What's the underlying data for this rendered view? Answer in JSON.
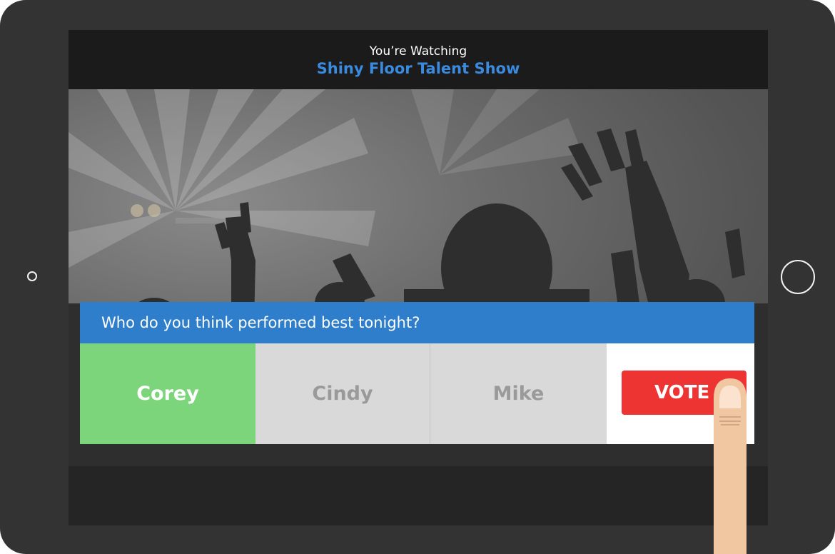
{
  "header": {
    "subtitle": "You’re Watching",
    "show_title": "Shiny Floor Talent Show"
  },
  "poll": {
    "question": "Who do you think performed best tonight?",
    "options": [
      {
        "label": "Corey",
        "selected": true
      },
      {
        "label": "Cindy",
        "selected": false
      },
      {
        "label": "Mike",
        "selected": false
      }
    ],
    "vote_label": "VOTE"
  },
  "colors": {
    "accent_blue": "#2f7ecb",
    "title_blue": "#3a8be0",
    "selected_green": "#7cd57a",
    "unselected_gray": "#d9d9d9",
    "vote_red": "#ee3333",
    "bezel": "#333333"
  },
  "icons": {
    "camera": "camera-dot-icon",
    "home": "home-button-icon",
    "pointer": "finger-pointer-icon"
  }
}
